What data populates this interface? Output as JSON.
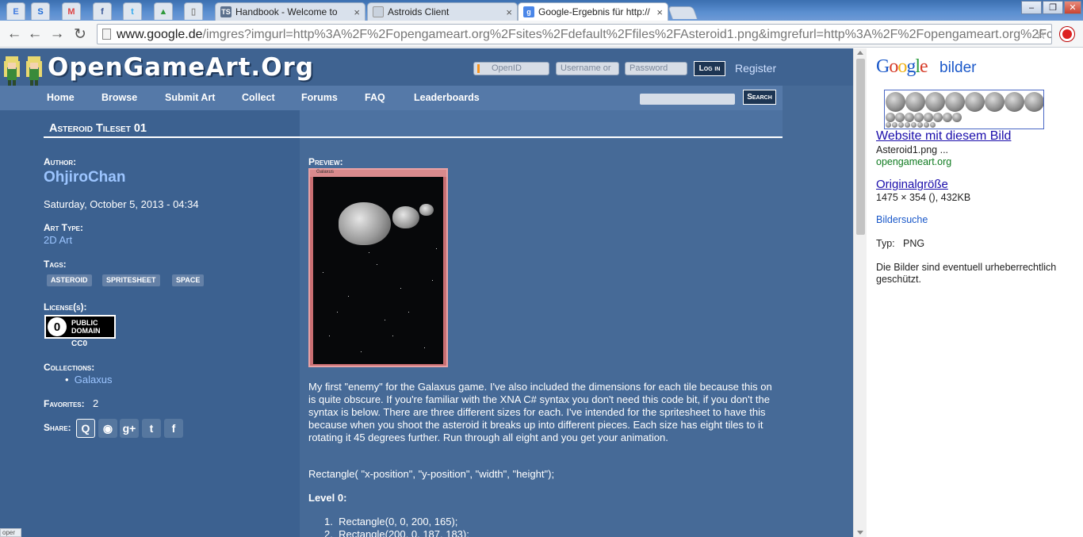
{
  "browser": {
    "pinned_tabs": [
      "E",
      "S",
      "M",
      "f",
      "t",
      "▲",
      "▯"
    ],
    "tabs": [
      {
        "title": "Handbook - Welcome to",
        "favicon": "TS"
      },
      {
        "title": "Astroids Client",
        "favicon": ""
      },
      {
        "title": "Google-Ergebnis für http://",
        "favicon": "g"
      }
    ],
    "window_controls": [
      "–",
      "❐",
      "✕"
    ],
    "address_host": "www.google.de",
    "address_rest": "/imgres?imgurl=http%3A%2F%2Fopengameart.org%2Fsites%2Fdefault%2Ffiles%2FAsteroid1.png&imgrefurl=http%3A%2F%2Fopengameart.org%2Fc"
  },
  "site": {
    "logo": "OpenGameArt.Org",
    "login": {
      "openid": "OpenID",
      "username": "Username or",
      "password": "Password",
      "login_label": "Log in",
      "register": "Register"
    },
    "nav": [
      "Home",
      "Browse",
      "Submit Art",
      "Collect",
      "Forums",
      "FAQ",
      "Leaderboards"
    ],
    "search_button": "Search"
  },
  "node": {
    "title": "Asteroid Tileset 01",
    "author_label": "Author:",
    "author": "OhjiroChan",
    "date": "Saturday, October 5, 2013 - 04:34",
    "art_type_label": "Art Type:",
    "art_type": "2D Art",
    "tags_label": "Tags:",
    "tags": [
      "ASTEROID",
      "SPRITESHEET",
      "SPACE"
    ],
    "license_label": "License(s):",
    "license_badge_line1": "PUBLIC",
    "license_badge_line2": "DOMAIN",
    "license": "CC0",
    "collections_label": "Collections:",
    "collection": "Galaxus",
    "favorites_label": "Favorites:",
    "favorites": "2",
    "share_label": "Share:",
    "share_icons": [
      "openid-share-icon",
      "reddit-icon",
      "google-plus-icon",
      "twitter-icon",
      "facebook-icon"
    ],
    "preview_label": "Preview:",
    "preview_window_title": "Galaxus",
    "description": "My first \"enemy\" for the Galaxus game. I've also included the dimensions for each tile because this on is quite obscure. If you're familiar with the XNA C# syntax you don't need this code bit, if you don't the syntax is below. There are three different sizes for each. I've intended for the spritesheet to have this because when you shoot the asteroid it breaks up into different pieces. Each size has eight tiles to it rotating it 45 degrees further. Run through all eight and you get your animation.",
    "syntax": "Rectangle( \"x-position\", \"y-position\", \"width\", \"height\");",
    "level_label": "Level 0:",
    "code_lines": [
      "Rectangle(0, 0, 200, 165);",
      "Rectangle(200, 0, 187, 183);"
    ]
  },
  "google_panel": {
    "logo": "Google",
    "subtitle": "bilder",
    "website_link": "Website mit diesem Bild",
    "filename": "Asteroid1.png ...",
    "domain": "opengameart.org",
    "original_link": "Originalgröße",
    "dimensions": "1475 × 354 (), 432KB",
    "search_link": "Bildersuche",
    "type_label": "Typ:",
    "type_value": "PNG",
    "copyright_note": "Die Bilder sind eventuell urheberrechtlich geschützt."
  },
  "status_bar": "oper"
}
